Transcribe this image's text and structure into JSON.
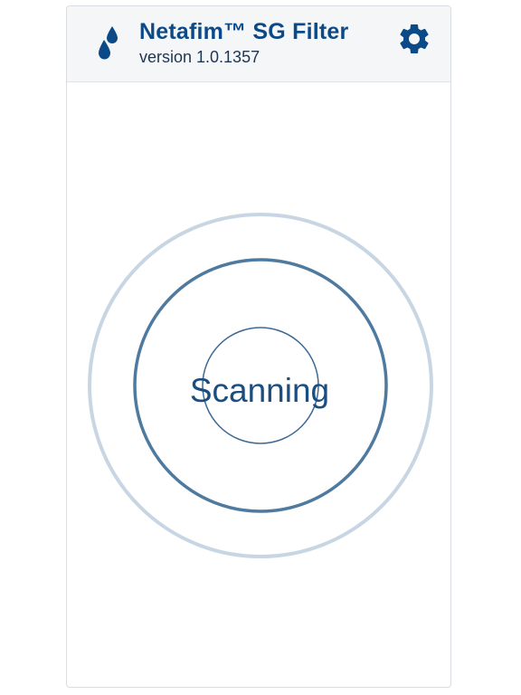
{
  "app": {
    "title": "Netafim™ SG Filter",
    "version": "version 1.0.1357"
  },
  "header": {
    "logo_icon": "water-drops-icon",
    "settings_icon": "gear-icon"
  },
  "scan": {
    "status": "Scanning"
  },
  "colors": {
    "brand": "#0b4a86",
    "header_bg": "#f5f6f8",
    "ring_outer": "#c8d6e4",
    "ring_middle": "#4f7aa0",
    "ring_inner": "#3e6a94"
  }
}
